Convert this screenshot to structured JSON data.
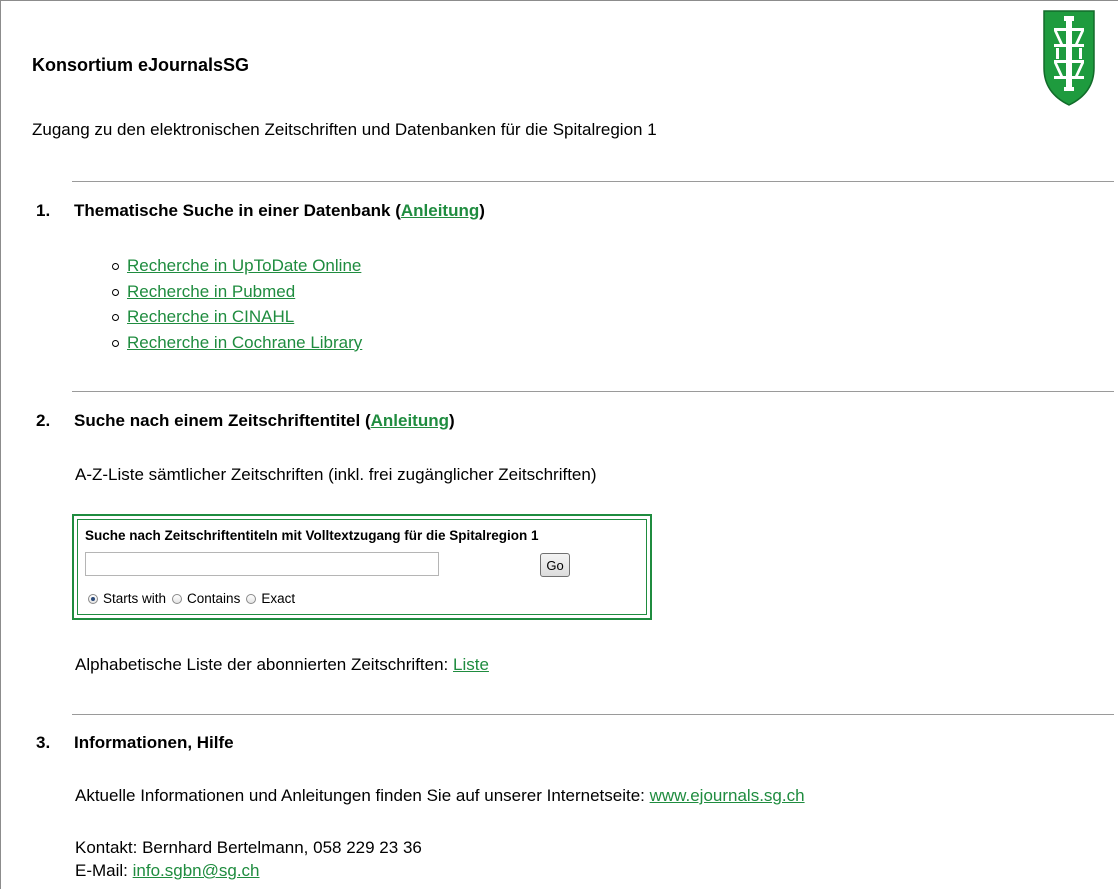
{
  "header": {
    "title": "Konsortium eJournalsSG",
    "intro": "Zugang zu den elektronischen Zeitschriften und Datenbanken für die Spitalregion 1"
  },
  "section1": {
    "number": "1.",
    "heading_prefix": "Thematische Suche in einer Datenbank (",
    "heading_link": "Anleitung",
    "heading_suffix": ")",
    "links": [
      "Recherche in UpToDate Online",
      "Recherche in Pubmed",
      "Recherche in CINAHL",
      "Recherche in Cochrane Library"
    ]
  },
  "section2": {
    "number": "2.",
    "heading_prefix": "Suche nach einem Zeitschriftentitel (",
    "heading_link": "Anleitung",
    "heading_suffix": ")",
    "az_text": "A-Z-Liste sämtlicher Zeitschriften (inkl. frei zugänglicher Zeitschriften)",
    "search": {
      "label": "Suche nach Zeitschriftentiteln mit Volltextzugang für die  Spitalregion 1",
      "input_value": "",
      "go_label": "Go",
      "options": [
        "Starts with",
        "Contains",
        "Exact"
      ],
      "selected": "Starts with"
    },
    "list_text": "Alphabetische Liste der abonnierten Zeitschriften: ",
    "list_link": "Liste"
  },
  "section3": {
    "number": "3.",
    "heading": "Informationen, Hilfe",
    "info_text": "Aktuelle Informationen und Anleitungen finden Sie auf unserer Internetseite: ",
    "info_link": "www.ejournals.sg.ch",
    "contact": "Kontakt: Bernhard Bertelmann, 058 229 23 36",
    "email_label": "E-Mail: ",
    "email_link": "info.sgbn@sg.ch"
  },
  "colors": {
    "link": "#1f8c3f",
    "crest_green": "#1e9b3e"
  },
  "icons": {
    "crest": "coat-of-arms-icon"
  }
}
